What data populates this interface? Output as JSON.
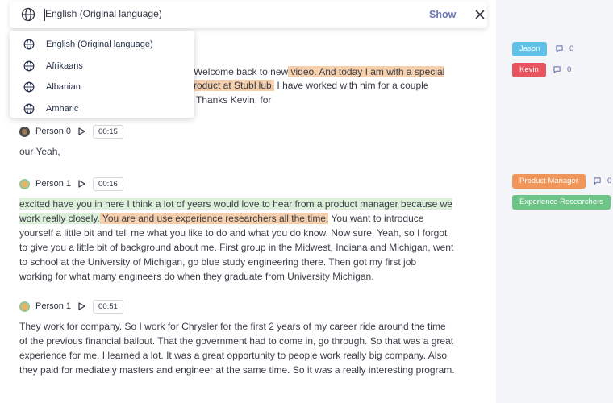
{
  "language_bar": {
    "selected_language": "English (Original language)",
    "show_label": "Show"
  },
  "dropdown": {
    "options": [
      "English (Original language)",
      "Afrikaans",
      "Albanian",
      "Amharic"
    ]
  },
  "transcript": {
    "intro": {
      "line1_plain": "Welcome back to new",
      "line1_hl": " video. And today I am with a special",
      "line2_hl": "roduct at StubHub.",
      "line2_plain": " I have worked with him for a couple",
      "line3": "Thanks Kevin, for"
    },
    "blocks": [
      {
        "speaker": "Person 0",
        "time": "00:15",
        "avatar_color": "#4a4a4a"
      },
      {
        "speaker": "Person 1",
        "time": "00:16",
        "avatar_color": "#d8b16a"
      },
      {
        "speaker": "Person 1",
        "time": "00:51",
        "avatar_color": "#d8b16a"
      }
    ],
    "block0_text": "our Yeah,",
    "block1": {
      "hl_green_1": "excited have you in here I think a lot of years would love to hear from a product manager because we",
      "hl_green_2": "work really closely.",
      "hl_orange": " You are and use experience researchers all the time.",
      "rest_1": " You want to introduce",
      "line3": "yourself a little bit and tell me what you like to do and what you do know. Now sure. Yeah, so I forgot",
      "line4": "to give you a little bit of background about me. First group in the Midwest, Indiana and Michigan, went",
      "line5": "to school at the University of Michigan, go blue study engineering there. Then got my first job",
      "line6": "working for what many engineers do when they graduate from University Michigan."
    },
    "block2": {
      "line1": "They work for company. So I work for Chrysler for the first 2 years of my career ride around the time",
      "line2": "of the previous financial bailout. That the government had to come in, go through. So that was a great",
      "line3": "experience for me. I learned a lot. It was a great opportunity to people work really big company. Also",
      "line4": "they paid for mediately masters and engineer at the same time. So it was a really interesting program."
    }
  },
  "tags": {
    "jason": {
      "label": "Jason",
      "color": "#5fc0e8",
      "comments": "0"
    },
    "kevin": {
      "label": "Kevin",
      "color": "#e8545d",
      "comments": "0"
    },
    "product_manager": {
      "label": "Product Manager",
      "color": "#f0965a",
      "comments": "0"
    },
    "experience_researchers": {
      "label": "Experience Researchers",
      "color": "#6cc486"
    }
  },
  "colors": {
    "accent": "#6b77b6",
    "highlight_orange": "#f6cfad",
    "highlight_green": "#dcefd9",
    "panel_bg": "#f4f5f8"
  }
}
